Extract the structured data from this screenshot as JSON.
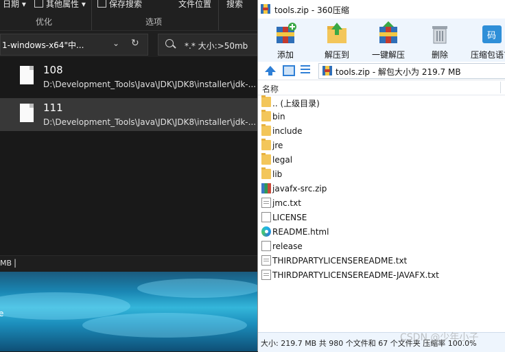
{
  "explorer": {
    "ribbon": {
      "items": [
        {
          "label": "日期",
          "has_dropdown": true
        },
        {
          "label": "其他属性",
          "has_dropdown": true
        },
        {
          "label": "保存搜索"
        },
        {
          "label": "文件位置"
        },
        {
          "label": "搜索"
        }
      ],
      "groups": [
        "优化",
        "选项"
      ]
    },
    "address": "1-windows-x64\"中...",
    "search": "*.* 大小:>50mb",
    "results": [
      {
        "name": "108",
        "path": "D:\\Development_Tools\\Java\\JDK\\JDK8\\installer\\jdk-..."
      },
      {
        "name": "111",
        "path": "D:\\Development_Tools\\Java\\JDK\\JDK8\\installer\\jdk-..."
      }
    ],
    "status": "MB",
    "status_caret": "|"
  },
  "desktop": {
    "label": "e"
  },
  "zip": {
    "title": "tools.zip - 360压缩",
    "toolbar": [
      "添加",
      "解压到",
      "一键解压",
      "删除",
      "压缩包语言"
    ],
    "toolbar_badge": "码",
    "path": "tools.zip - 解包大小为 219.7 MB",
    "column_name": "名称",
    "files": [
      {
        "name": ".. (上级目录)",
        "icon": "folder"
      },
      {
        "name": "bin",
        "icon": "folder"
      },
      {
        "name": "include",
        "icon": "folder"
      },
      {
        "name": "jre",
        "icon": "folder"
      },
      {
        "name": "legal",
        "icon": "folder"
      },
      {
        "name": "lib",
        "icon": "folder"
      },
      {
        "name": "javafx-src.zip",
        "icon": "zip"
      },
      {
        "name": "jmc.txt",
        "icon": "txt"
      },
      {
        "name": "LICENSE",
        "icon": "blank"
      },
      {
        "name": "README.html",
        "icon": "edge"
      },
      {
        "name": "release",
        "icon": "blank"
      },
      {
        "name": "THIRDPARTYLICENSEREADME.txt",
        "icon": "txt"
      },
      {
        "name": "THIRDPARTYLICENSEREADME-JAVAFX.txt",
        "icon": "txt"
      }
    ],
    "status": "大小: 219.7 MB 共 980 个文件和 67 个文件夹 压缩率 100.0%"
  },
  "watermark": "CSDN @少年小子",
  "colors": {
    "explorer_bg": "#191919",
    "zip_toolbar_bg": "#eef5fd",
    "accent": "#2e7fd6",
    "folder": "#f3c65a"
  }
}
